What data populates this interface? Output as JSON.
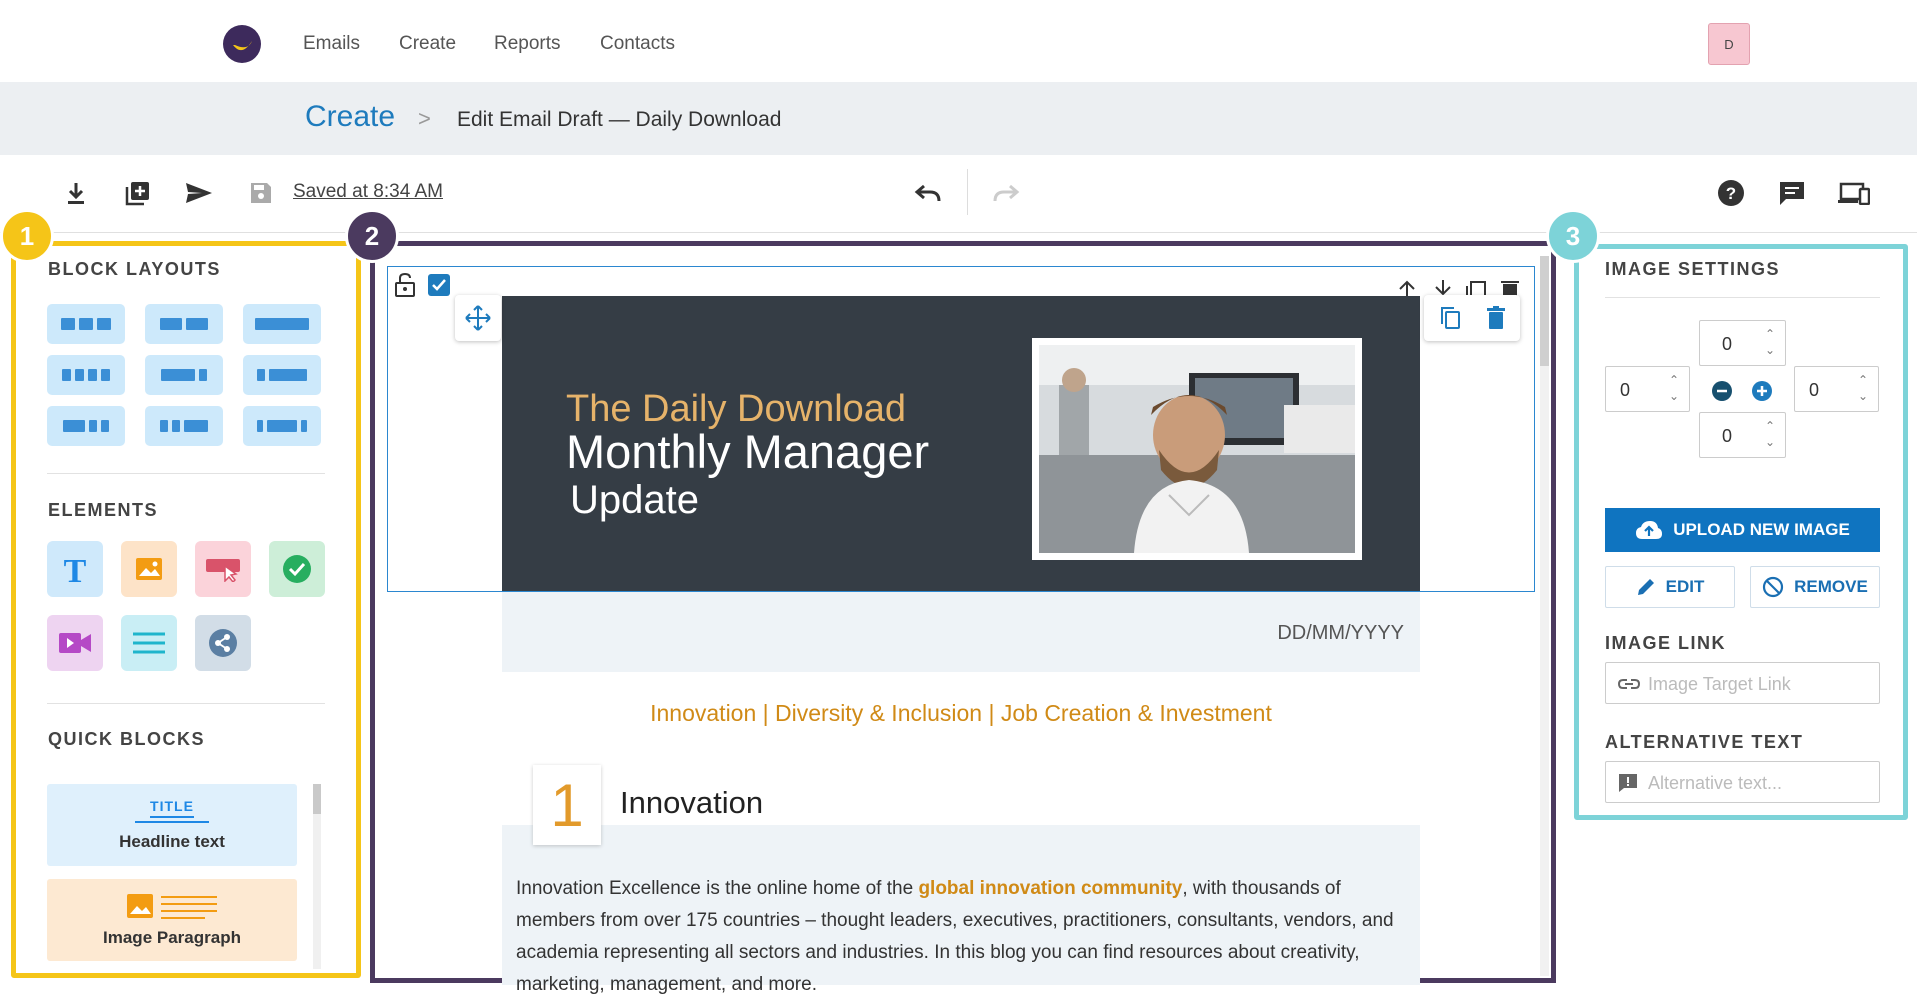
{
  "nav": {
    "items": [
      "Emails",
      "Create",
      "Reports",
      "Contacts"
    ],
    "avatar": "D"
  },
  "breadcrumb": {
    "root": "Create",
    "separator": ">",
    "current": "Edit Email Draft — Daily Download"
  },
  "toolbar": {
    "saved": "Saved at 8:34 AM",
    "icons": [
      "download-icon",
      "add-icon",
      "send-icon",
      "save-icon",
      "undo-icon",
      "redo-icon",
      "help-icon",
      "comment-icon",
      "devices-icon"
    ]
  },
  "badges": {
    "one": "1",
    "two": "2",
    "three": "3"
  },
  "left_panel": {
    "block_layouts_title": "BLOCK LAYOUTS",
    "elements_title": "ELEMENTS",
    "element_icons": [
      "text-icon",
      "image-icon",
      "button-icon",
      "check-icon",
      "video-icon",
      "divider-icon",
      "share-icon"
    ],
    "quick_blocks_title": "QUICK BLOCKS",
    "quick_blocks": [
      {
        "tag": "TITLE",
        "label": "Headline text"
      },
      {
        "label": "Image Paragraph"
      }
    ]
  },
  "email": {
    "hero_line1": "The Daily Download",
    "hero_line2": "Monthly Manager",
    "hero_line3": "Update",
    "date": "DD/MM/YYYY",
    "topics": "Innovation | Diversity & Inclusion | Job Creation & Investment",
    "section_number": "1",
    "section_title": "Innovation",
    "body_pre": "Innovation Excellence is the online home of the ",
    "body_link": "global innovation community",
    "body_post": ", with thousands of members from over 175 countries – thought leaders, executives, practitioners, consultants, vendors, and academia representing all sectors and industries. In this blog you can find resources about creativity, marketing, management, and more."
  },
  "right_panel": {
    "image_settings_title": "IMAGE SETTINGS",
    "padding": {
      "top": "0",
      "left": "0",
      "right": "0",
      "bottom": "0"
    },
    "upload_label": "UPLOAD NEW IMAGE",
    "edit_label": "EDIT",
    "remove_label": "REMOVE",
    "image_link_title": "IMAGE LINK",
    "image_link_placeholder": "Image Target Link",
    "alt_text_title": "ALTERNATIVE TEXT",
    "alt_text_placeholder": "Alternative text..."
  },
  "colors": {
    "accent": "#1e7bbd",
    "panel1": "#f5c518",
    "panel2": "#4b3a5f",
    "panel3": "#7dd3d8",
    "orange": "#d08a16"
  }
}
